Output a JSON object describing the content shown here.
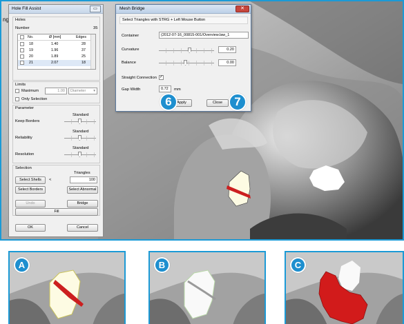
{
  "partial_text": "ng",
  "hole_fill_assist": {
    "title": "Hole Fill Assist",
    "holes_label": "Holes",
    "number_label": "Number",
    "number_value": "35",
    "table": {
      "headers": [
        "No.",
        "Ø [mm]",
        "Edges"
      ],
      "rows": [
        {
          "no": "18",
          "dia": "1.40",
          "edges": "28"
        },
        {
          "no": "19",
          "dia": "1.96",
          "edges": "37"
        },
        {
          "no": "20",
          "dia": "1.89",
          "edges": "25"
        },
        {
          "no": "21",
          "dia": "2.07",
          "edges": "18"
        }
      ]
    },
    "units_label": "Limits",
    "maximum_label": "Maximum",
    "maximum_value": "1.00",
    "unit_select": "Diameter",
    "only_selection_label": "Only Selection",
    "parameter_label": "Parameter",
    "keep_borders_label": "Keep Borders",
    "keep_borders_value": "Standard",
    "reliability_label": "Reliability",
    "reliability_value": "Standard",
    "resolution_label": "Resolution",
    "resolution_value": "Standard",
    "selection_label": "Selection",
    "triangles_label": "Triangles",
    "select_shells": "Select Shells",
    "lt": "<",
    "triangles_value": "100",
    "select_borders": "Select Borders",
    "select_abnormal": "Select Abnormal",
    "undo": "Undo",
    "bridge": "Bridge",
    "fill": "Fill",
    "ok": "OK",
    "cancel": "Cancel"
  },
  "mesh_bridge": {
    "title": "Mesh Bridge",
    "hint": "Select Triangles with STRG + Left Mouse Button",
    "container_label": "Container",
    "container_value": "(2012-07-16_00815-001/Overview.law_1",
    "curvature_label": "Curvature",
    "curvature_value": "0.20",
    "balance_label": "Balance",
    "balance_value": "0.00",
    "straight_label": "Straight Connection",
    "gap_label": "Gap Width",
    "gap_value": "0.72",
    "gap_unit": "mm",
    "apply": "Apply",
    "close": "Close"
  },
  "markers": {
    "six": "6",
    "seven": "7",
    "a": "A",
    "b": "B",
    "c": "C"
  },
  "colors": {
    "accent": "#1b9ad6",
    "marker": "#1e8fcf",
    "bridge_red": "#cc1f1f"
  }
}
